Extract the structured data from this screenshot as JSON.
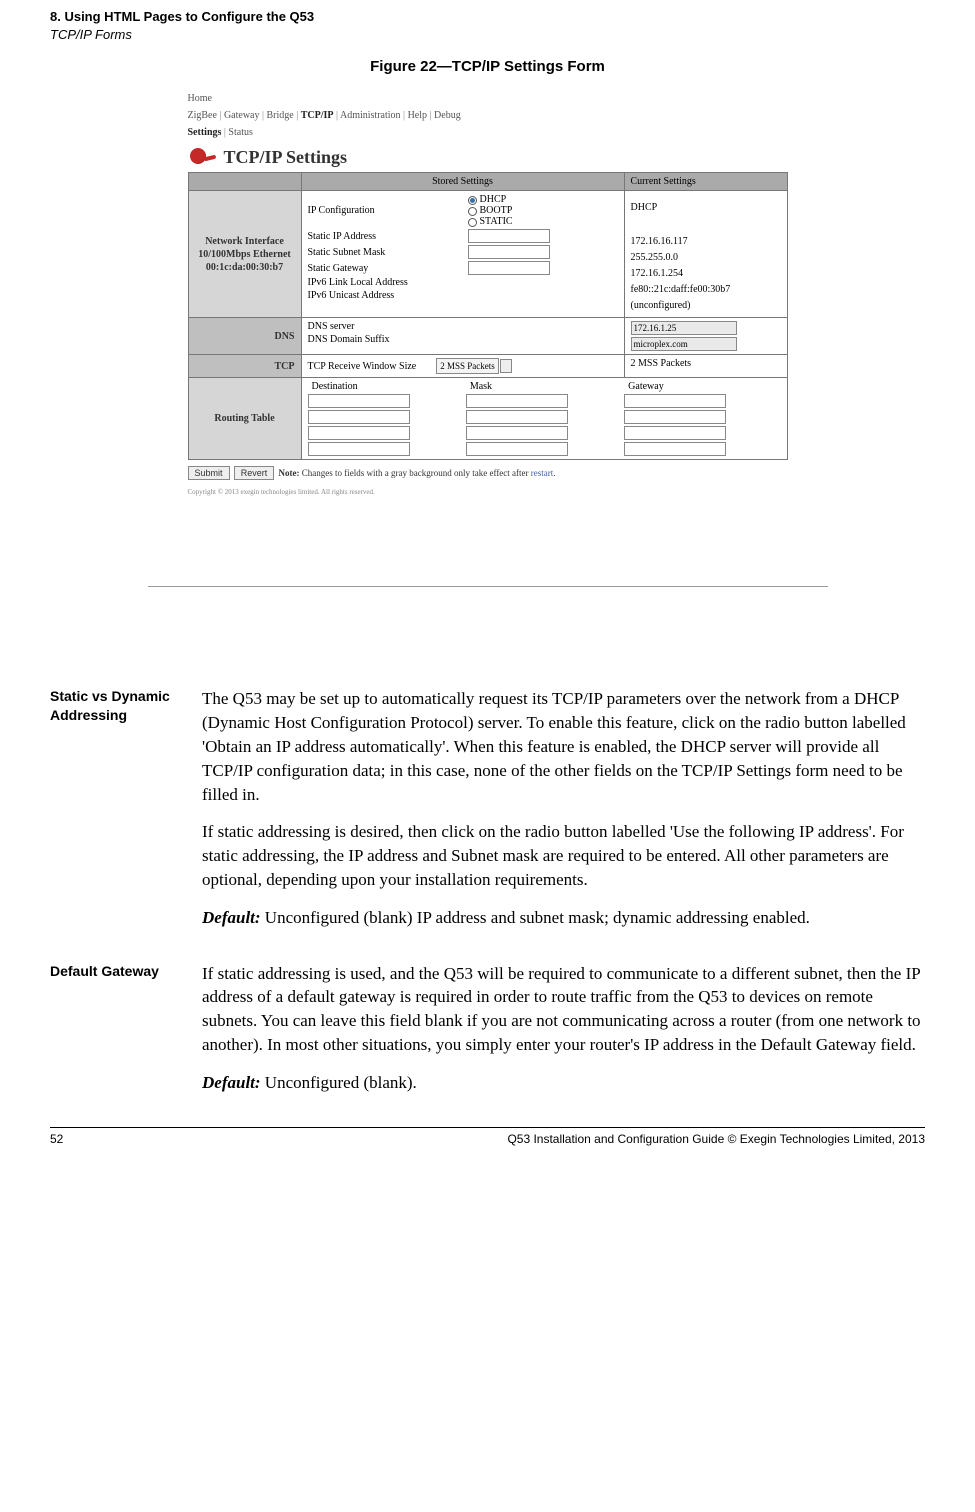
{
  "running_header": {
    "line1": "8. Using HTML Pages to Configure the Q53",
    "line2": "TCP/IP Forms"
  },
  "figure_caption": "Figure 22—TCP/IP Settings Form",
  "screenshot": {
    "breadcrumb1": {
      "items": [
        "Home"
      ]
    },
    "breadcrumb2": {
      "items": [
        "ZigBee",
        "Gateway",
        "Bridge",
        "TCP/IP",
        "Administration",
        "Help",
        "Debug"
      ],
      "active": "TCP/IP"
    },
    "breadcrumb3": {
      "items": [
        "Settings",
        "Status"
      ],
      "active": "Settings"
    },
    "title": "TCP/IP Settings",
    "col_stored": "Stored Settings",
    "col_current": "Current Settings",
    "netif": {
      "label_l1": "Network Interface",
      "label_l2": "10/100Mbps Ethernet",
      "label_l3": "00:1c:da:00:30:b7",
      "ipconf_label": "IP Configuration",
      "ipconf_opts": [
        "DHCP",
        "BOOTP",
        "STATIC"
      ],
      "ipconf_current": "DHCP",
      "static_ip_label": "Static IP Address",
      "static_ip_current": "172.16.16.117",
      "subnet_label": "Static Subnet Mask",
      "subnet_current": "255.255.0.0",
      "gateway_label": "Static Gateway",
      "gateway_current": "172.16.1.254",
      "ipv6ll_label": "IPv6 Link Local Address",
      "ipv6ll_current": "fe80::21c:daff:fe00:30b7",
      "ipv6uni_label": "IPv6 Unicast Address",
      "ipv6uni_current": "(unconfigured)"
    },
    "dns": {
      "label": "DNS",
      "server_label": "DNS server",
      "server_value": "172.16.1.25",
      "suffix_label": "DNS Domain Suffix",
      "suffix_value": "microplex.com"
    },
    "tcp": {
      "label": "TCP",
      "win_label": "TCP Receive Window Size",
      "win_stored": "2 MSS Packets",
      "win_current": "2 MSS Packets"
    },
    "routing": {
      "label": "Routing Table",
      "cols": [
        "Destination",
        "Mask",
        "Gateway"
      ]
    },
    "buttons": {
      "submit": "Submit",
      "revert": "Revert"
    },
    "note_prefix": "Note:",
    "note_body": "Changes to fields with a gray background only take effect after ",
    "note_link": "restart",
    "copyright": "Copyright © 2013 exegin technologies limited. All rights reserved."
  },
  "sections": {
    "static_dynamic": {
      "label": "Static vs Dynamic Addressing",
      "p1": "The Q53 may be set up to automatically request its TCP/IP parameters over the network from a DHCP (Dynamic Host Configuration Protocol) server. To enable this feature, click on the radio button labelled 'Obtain an IP address automatically'. When this feature is enabled, the DHCP server will provide all TCP/IP configuration data; in this case, none of the other fields on the TCP/IP Settings form need to be filled in.",
      "p2": "If static addressing is desired, then click on the radio button labelled 'Use the following IP address'. For static addressing, the IP address and Subnet mask are required to be entered. All other parameters are optional, depending upon your installation requirements.",
      "default_label": "Default:",
      "default_text": " Unconfigured (blank) IP address and subnet mask; dynamic addressing enabled."
    },
    "default_gateway": {
      "label": "Default Gateway",
      "p1": "If static addressing is used, and the Q53 will be required to communicate to a different subnet, then the IP address of a default gateway is required in order to route traffic from the Q53 to devices on remote subnets. You can leave this field blank if you are not communicating across a router (from one network to another). In most other situations, you simply enter your router's IP address in the Default Gateway field.",
      "default_label": "Default:",
      "default_text": " Unconfigured (blank)."
    }
  },
  "footer": {
    "page": "52",
    "text": "Q53 Installation and Configuration Guide  © Exegin Technologies Limited, 2013"
  }
}
